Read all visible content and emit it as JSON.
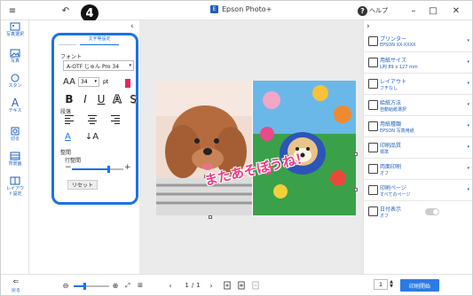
{
  "titlebar": {
    "app_name": "Epson Photo+",
    "logo_letter": "E",
    "help_label": "ヘルプ",
    "help_glyph": "?",
    "menu_glyph": "≡",
    "undo_glyph": "↶",
    "minimize_glyph": "–",
    "maximize_glyph": "□",
    "close_glyph": "✕"
  },
  "callout": {
    "number": "4"
  },
  "left_toolbar": {
    "items": [
      {
        "label": "写真選択",
        "icon": "photo-select-icon"
      },
      {
        "label": "写真",
        "icon": "photo-icon"
      },
      {
        "label": "スタン",
        "icon": "stamp-icon"
      },
      {
        "label": "テキス",
        "icon": "text-icon",
        "glyph": "A"
      },
      {
        "label": "切る",
        "icon": "crop-icon"
      },
      {
        "label": "背景画",
        "icon": "background-icon"
      },
      {
        "label": "レイアウト設定",
        "icon": "layout-settings-icon"
      }
    ],
    "back_label": "戻る"
  },
  "text_panel": {
    "tab_label": "文字等設定",
    "collapse_glyph": "‹",
    "font_label": "フォント",
    "font_value": "A-OTF じゅん Pro 34",
    "size_glyph": "AA",
    "size_value": "34",
    "size_unit": "pt",
    "text_color": "#e8265d",
    "styles": [
      "B",
      "I",
      "U",
      "A",
      "S"
    ],
    "paragraph_label": "段落",
    "spacing_label": "整間",
    "line_spacing_label": "行整間",
    "line_spacing_percent": 70,
    "minus_glyph": "−",
    "plus_glyph": "+",
    "reset_label": "リセット",
    "direction_glyphs": [
      "A",
      "↓A"
    ]
  },
  "canvas": {
    "caption_text": "またあそぼうね！"
  },
  "right_panel": {
    "collapse_glyph": "›",
    "rows": [
      {
        "title": "プリンター",
        "value": "EPSON XX-XXXX",
        "icon": "printer-icon"
      },
      {
        "title": "用紙サイズ",
        "value": "L判 89 x 127 mm",
        "icon": "paper-size-icon"
      },
      {
        "title": "レイアウト",
        "value": "フチなし",
        "icon": "layout-icon"
      },
      {
        "title": "給紙方法",
        "value": "自動給紙選択",
        "icon": "paper-feed-icon"
      },
      {
        "title": "用紙種類",
        "value": "EPSON 写真用紙",
        "icon": "paper-type-icon"
      },
      {
        "title": "印刷品質",
        "value": "標準",
        "icon": "print-quality-icon"
      },
      {
        "title": "両面印刷",
        "value": "オフ",
        "icon": "duplex-icon"
      },
      {
        "title": "印刷ページ",
        "value": "すべてのページ",
        "icon": "print-pages-icon"
      },
      {
        "title": "日付表示",
        "value": "オフ",
        "icon": "date-icon"
      }
    ],
    "date_toggle_on": false
  },
  "bottombar": {
    "zoom_out_glyph": "⊖",
    "zoom_in_glyph": "⊕",
    "zoom_percent": 30,
    "page_current": "1",
    "page_separator": "/",
    "page_total": "1",
    "prev_glyph": "‹",
    "next_glyph": "›",
    "copies": "1",
    "print_label": "印刷開始"
  },
  "colors": {
    "accent": "#1a72e6",
    "label_blue": "#1f5fbf",
    "caption_pink": "#ee3c86",
    "print_button": "#2b7be4"
  }
}
